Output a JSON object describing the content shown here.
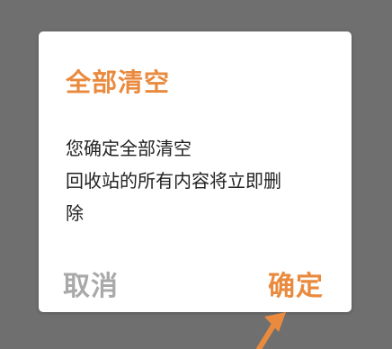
{
  "dialog": {
    "title": "全部清空",
    "message_lines": [
      "您确定全部清空",
      "回收站的所有内容将立即删",
      "除"
    ],
    "cancel_label": "取消",
    "confirm_label": "确定"
  },
  "colors": {
    "accent": "#e98a3e",
    "cancel_text": "#a9a9a9",
    "message_text": "#222222",
    "overlay": "#6f6f6f",
    "dialog_background": "#ffffff"
  },
  "annotation": {
    "icon": "arrow-pointer-icon"
  }
}
